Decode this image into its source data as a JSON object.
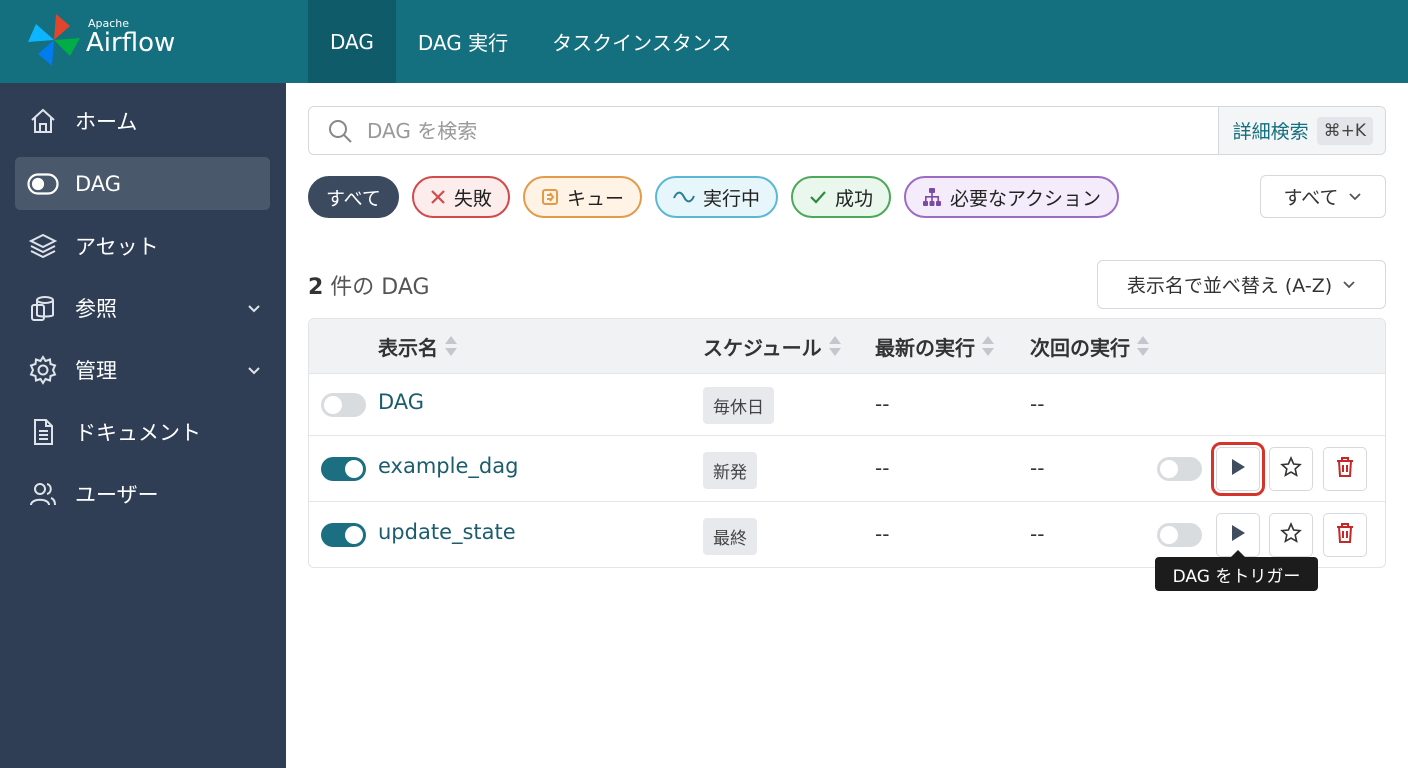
{
  "app": {
    "brand_small": "Apache",
    "brand_large": "Airflow"
  },
  "topnav": {
    "tabs": [
      {
        "label": "DAG"
      },
      {
        "label": "DAG 実行"
      },
      {
        "label": "タスクインスタンス"
      }
    ]
  },
  "sidebar": {
    "items": [
      {
        "label": "ホーム",
        "icon": "home-icon"
      },
      {
        "label": "DAG",
        "icon": "dag-toggle-icon"
      },
      {
        "label": "アセット",
        "icon": "layers-icon"
      },
      {
        "label": "参照",
        "icon": "browse-icon"
      },
      {
        "label": "管理",
        "icon": "gear-icon"
      },
      {
        "label": "ドキュメント",
        "icon": "document-icon"
      },
      {
        "label": "ユーザー",
        "icon": "users-icon"
      }
    ]
  },
  "search": {
    "placeholder": "DAG を検索",
    "advanced_label": "詳細検索",
    "shortcut": "⌘+K"
  },
  "filters": [
    {
      "label": "すべて"
    },
    {
      "label": "失敗"
    },
    {
      "label": "キュー"
    },
    {
      "label": "実行中"
    },
    {
      "label": "成功"
    },
    {
      "label": "必要なアクション"
    }
  ],
  "filter_select": {
    "value": "すべて"
  },
  "summary": {
    "count": "2",
    "suffix": " 件の DAG"
  },
  "sort_select": {
    "value": "表示名で並べ替え (A-Z)"
  },
  "table": {
    "columns": [
      "表示名",
      "スケジュール",
      "最新の実行",
      "次回の実行"
    ],
    "rows": [
      {
        "name": "DAG",
        "schedule": "毎休日",
        "last_run": "--",
        "next_run": "--",
        "enabled": false
      },
      {
        "name": "example_dag",
        "schedule": "新発",
        "last_run": "--",
        "next_run": "--",
        "enabled": true
      },
      {
        "name": "update_state",
        "schedule": "最終",
        "last_run": "--",
        "next_run": "--",
        "enabled": true
      }
    ]
  },
  "tooltip": {
    "text": "DAG をトリガー"
  },
  "colors": {
    "header": "#146f7f",
    "sidebar": "#2f3e55",
    "accent": "#1b6f80",
    "danger": "#c62828"
  }
}
